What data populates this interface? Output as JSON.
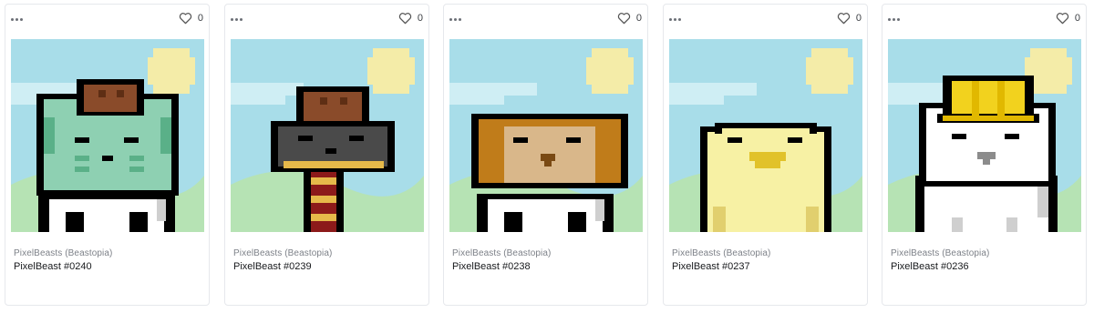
{
  "cards": [
    {
      "collection": "PixelBeasts (Beastopia)",
      "title": "PixelBeast #0240",
      "likes": "0",
      "body_color": "#8ed0b2",
      "accent_color": "#5ab088",
      "hat": "brown-crown",
      "neck": "white-shirt"
    },
    {
      "collection": "PixelBeasts (Beastopia)",
      "title": "PixelBeast #0239",
      "likes": "0",
      "body_color": "#4a4a4a",
      "accent_color": "#e6b94a",
      "hat": "brown-crown",
      "neck": "striped-scarf"
    },
    {
      "collection": "PixelBeasts (Beastopia)",
      "title": "PixelBeast #0238",
      "likes": "0",
      "body_color": "#c07c1a",
      "accent_color": "#d9b78a",
      "hat": "none",
      "neck": "white-shirt"
    },
    {
      "collection": "PixelBeasts (Beastopia)",
      "title": "PixelBeast #0237",
      "likes": "0",
      "body_color": "#f7f1a4",
      "accent_color": "#e1c22a",
      "hat": "none",
      "neck": "none"
    },
    {
      "collection": "PixelBeasts (Beastopia)",
      "title": "PixelBeast #0236",
      "likes": "0",
      "body_color": "#ffffff",
      "accent_color": "#f2d21e",
      "hat": "yellow-hardhat",
      "neck": "white-shirt"
    }
  ],
  "colors": {
    "sky": "#a8dde9",
    "sun": "#f4eca8",
    "grass": "#b6e3b4",
    "outline": "#000000"
  },
  "icons": {
    "more": "more-horizontal-icon",
    "like": "heart-outline-icon"
  }
}
